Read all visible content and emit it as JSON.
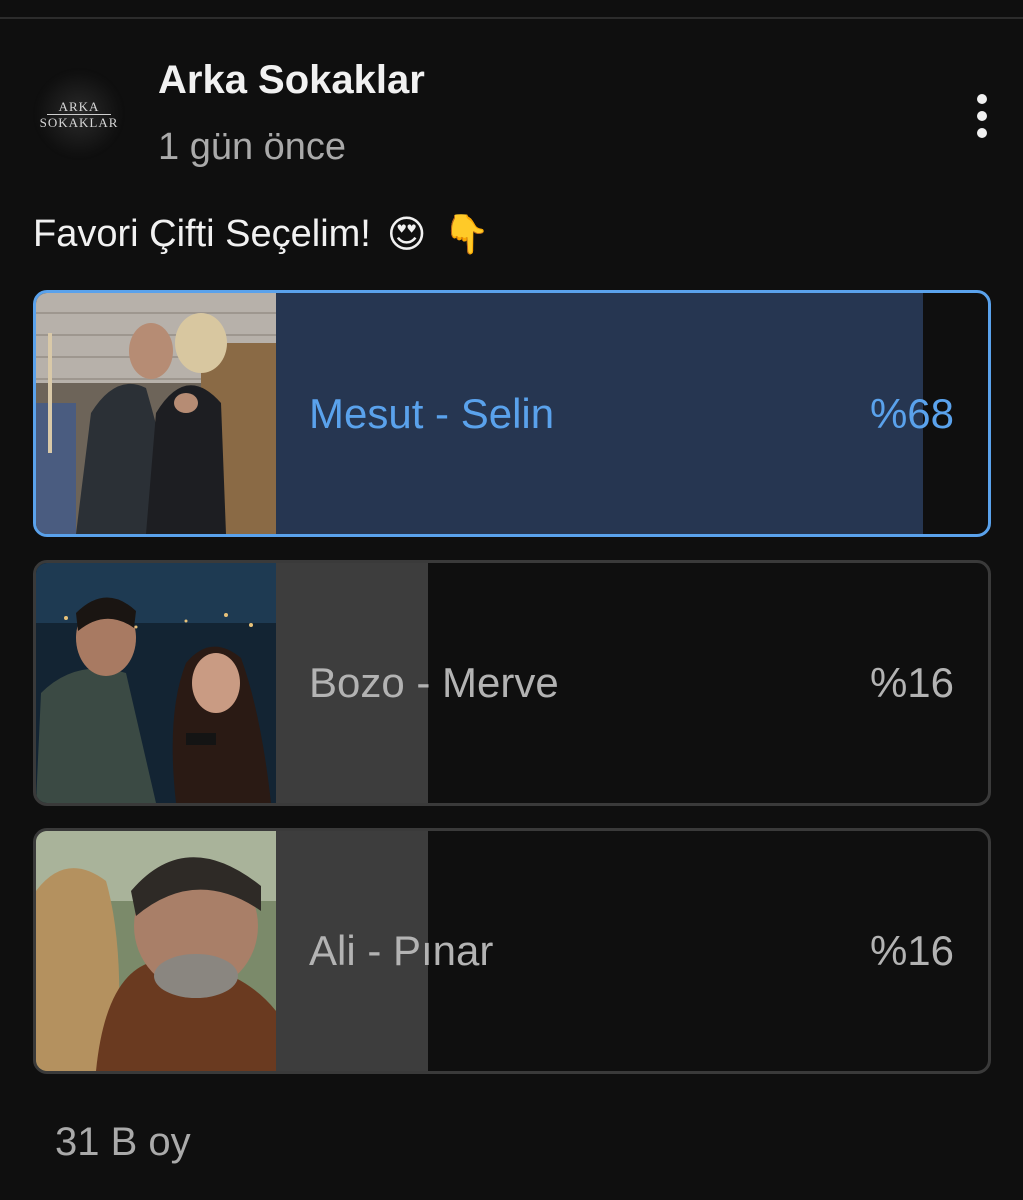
{
  "channel": {
    "name": "Arka Sokaklar",
    "avatar_text_top": "ARKA",
    "avatar_text_bottom": "SOKAKLAR",
    "time": "1 gün önce"
  },
  "post": {
    "text": "Favori Çifti Seçelim!",
    "emoji_1": "😍",
    "emoji_2": "👇"
  },
  "poll": {
    "options": [
      {
        "label": "Mesut - Selin",
        "percent_text": "%68",
        "percent": 68,
        "selected": true,
        "image": "couple-kissing-photo"
      },
      {
        "label": "Bozo - Merve",
        "percent_text": "%16",
        "percent": 16,
        "selected": false,
        "image": "couple-night-city-photo"
      },
      {
        "label": "Ali - Pınar",
        "percent_text": "%16",
        "percent": 16,
        "selected": false,
        "image": "couple-hugging-photo"
      }
    ],
    "votes": "31 B oy"
  },
  "colors": {
    "background": "#0f0f0f",
    "accent": "#5aa2ec",
    "selected_fill": "#263651",
    "unselected_fill": "#3d3d3d",
    "muted_text": "#aaaaaa"
  },
  "icons": {
    "more": "more-vert-icon"
  }
}
